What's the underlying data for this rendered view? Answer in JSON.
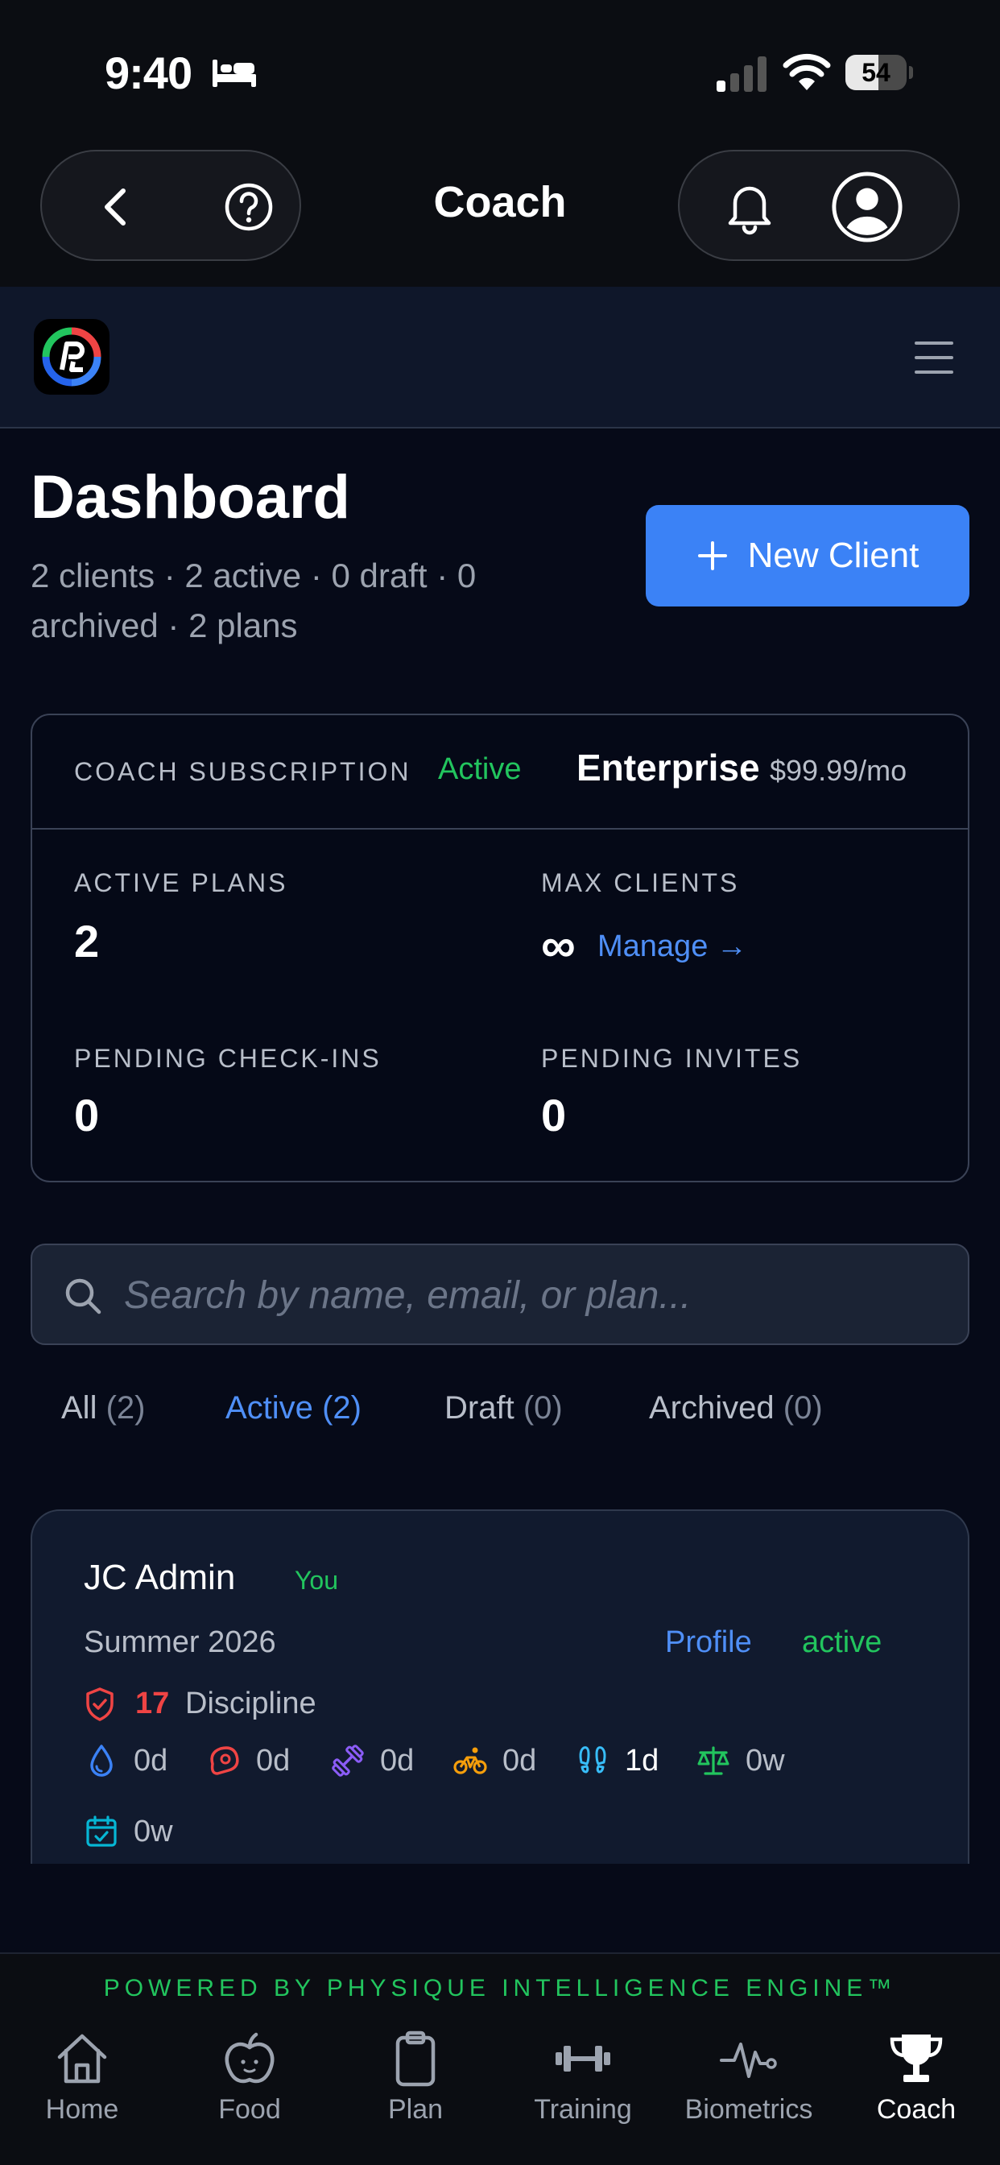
{
  "status_bar": {
    "time": "9:40",
    "battery": "54",
    "battery_level": 0.54
  },
  "header": {
    "title": "Coach"
  },
  "dashboard": {
    "title": "Dashboard",
    "subtitle": "2 clients · 2 active · 0 draft · 0 archived · 2 plans",
    "new_client_label": "New Client"
  },
  "subscription": {
    "label": "COACH SUBSCRIPTION",
    "status": "Active",
    "tier": "Enterprise",
    "price": "$99.99/mo",
    "stats": {
      "active_plans_label": "ACTIVE PLANS",
      "active_plans_value": "2",
      "max_clients_label": "MAX CLIENTS",
      "max_clients_value": "∞",
      "manage_label": "Manage →",
      "pending_checkins_label": "PENDING CHECK-INS",
      "pending_checkins_value": "0",
      "pending_invites_label": "PENDING INVITES",
      "pending_invites_value": "0"
    }
  },
  "search": {
    "placeholder": "Search by name, email, or plan..."
  },
  "tabs": [
    {
      "label": "All",
      "count": "(2)"
    },
    {
      "label": "Active",
      "count": "(2)"
    },
    {
      "label": "Draft",
      "count": "(0)"
    },
    {
      "label": "Archived",
      "count": "(0)"
    }
  ],
  "client": {
    "name": "JC Admin",
    "badge": "You",
    "plan": "Summer 2026",
    "profile_label": "Profile",
    "status": "active",
    "discipline_value": "17",
    "discipline_label": "Discipline",
    "metrics": [
      {
        "icon": "water-drop-icon",
        "value": "0d",
        "color": "#3b82f6"
      },
      {
        "icon": "steak-icon",
        "value": "0d",
        "color": "#ef4444"
      },
      {
        "icon": "dumbbell-icon",
        "value": "0d",
        "color": "#8b5cf6"
      },
      {
        "icon": "bicycle-icon",
        "value": "0d",
        "color": "#f59e0b"
      },
      {
        "icon": "footprints-icon",
        "value": "1d",
        "color": "#38bdf8"
      },
      {
        "icon": "scale-icon",
        "value": "0w",
        "color": "#22c55e"
      },
      {
        "icon": "calendar-check-icon",
        "value": "0w",
        "color": "#06b6d4"
      }
    ]
  },
  "footer": {
    "powered_by": "POWERED BY PHYSIQUE INTELLIGENCE ENGINE™"
  },
  "bottom_nav": [
    {
      "label": "Home",
      "icon": "home-icon"
    },
    {
      "label": "Food",
      "icon": "apple-icon"
    },
    {
      "label": "Plan",
      "icon": "clipboard-icon"
    },
    {
      "label": "Training",
      "icon": "dumbbell-icon"
    },
    {
      "label": "Biometrics",
      "icon": "heartbeat-icon"
    },
    {
      "label": "Coach",
      "icon": "trophy-icon",
      "active": true
    }
  ]
}
